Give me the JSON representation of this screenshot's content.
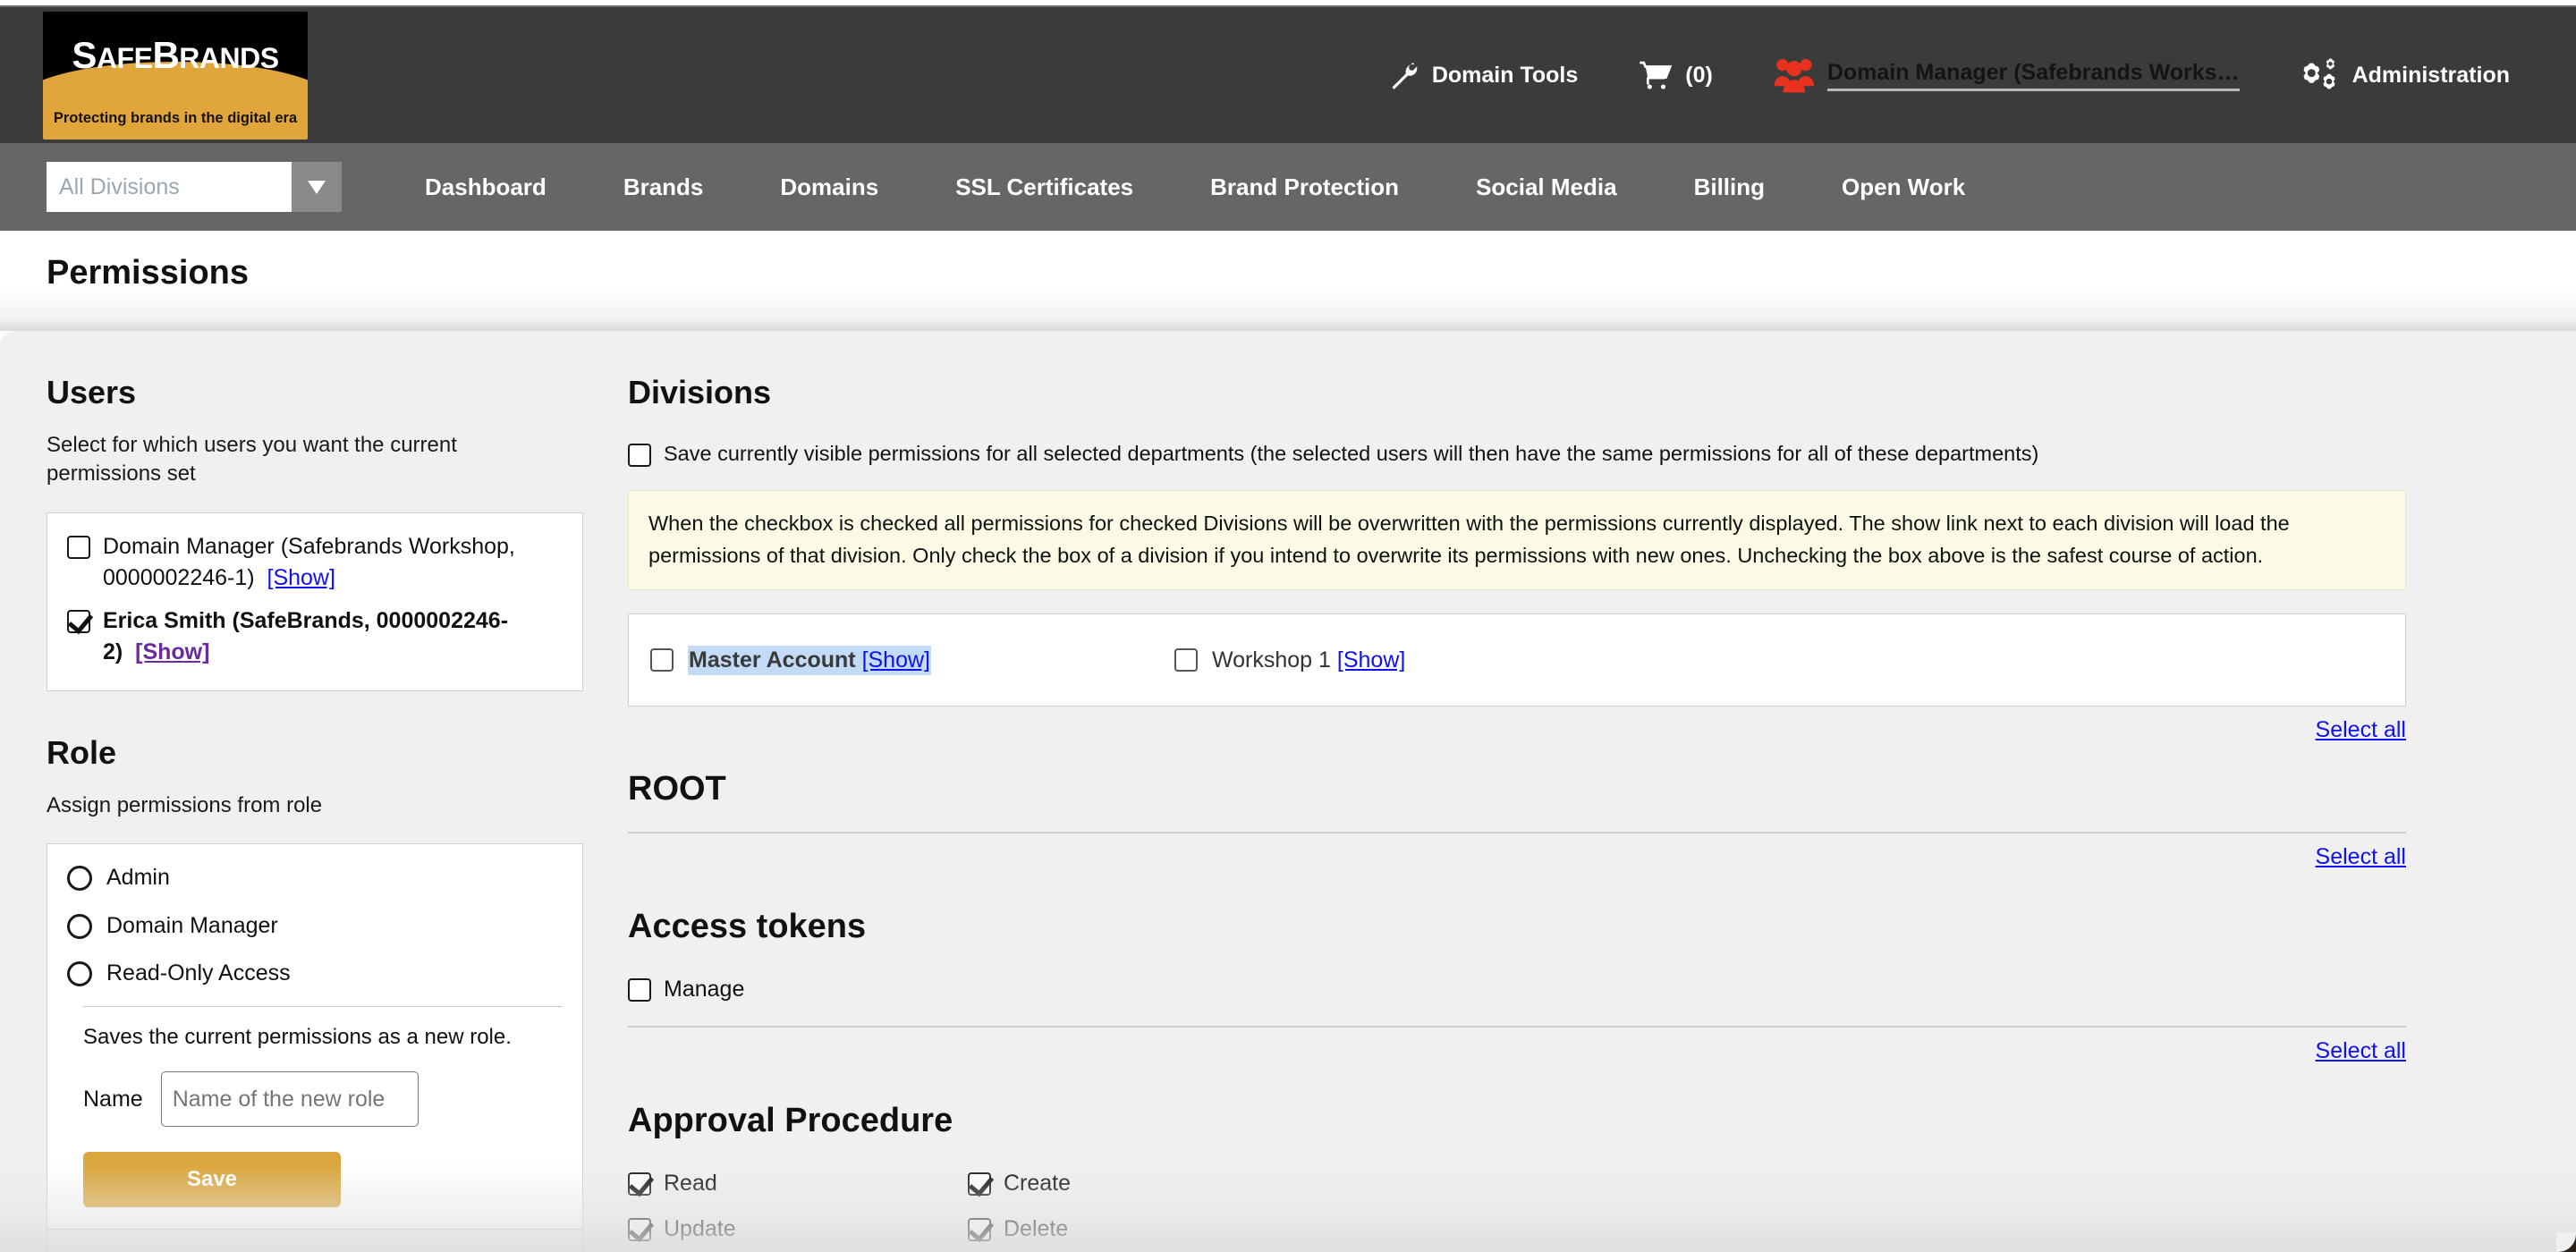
{
  "brand": {
    "logo_title_parts": [
      "S",
      "AFE",
      "B",
      "RANDS"
    ],
    "logo_tagline": "Protecting brands in the digital era"
  },
  "header": {
    "items": [
      {
        "label": "Domain Tools",
        "icon": "wrench-icon"
      },
      {
        "label": "(0)",
        "icon": "cart-icon"
      },
      {
        "label": "Domain Manager (Safebrands Works…",
        "icon": "users-icon"
      },
      {
        "label": "Administration",
        "icon": "gears-icon"
      }
    ]
  },
  "navbar": {
    "division_placeholder": "All Divisions",
    "division_value": "",
    "links": [
      "Dashboard",
      "Brands",
      "Domains",
      "SSL Certificates",
      "Brand Protection",
      "Social Media",
      "Billing",
      "Open Work"
    ]
  },
  "page": {
    "title": "Permissions"
  },
  "users": {
    "heading": "Users",
    "description": "Select for which users you want the current permissions set",
    "items": [
      {
        "label": "Domain Manager (Safebrands Workshop, 0000002246-1)",
        "show_link": "[Show]",
        "checked": false,
        "bold": false,
        "visited": false
      },
      {
        "label": "Erica Smith (SafeBrands, 0000002246-2)",
        "show_link": "[Show]",
        "checked": true,
        "bold": true,
        "visited": true
      }
    ]
  },
  "role": {
    "heading": "Role",
    "description": "Assign permissions from role",
    "options": [
      "Admin",
      "Domain Manager",
      "Read-Only Access"
    ],
    "note": "Saves the current permissions as a new role.",
    "name_label": "Name",
    "name_placeholder": "Name of the new role",
    "name_value": "",
    "save_label": "Save"
  },
  "divisions": {
    "heading": "Divisions",
    "save_all_label": "Save currently visible permissions for all selected departments (the selected users will then have the same permissions for all of these departments)",
    "save_all_checked": false,
    "warning": "When the checkbox is checked all permissions for checked Divisions will be overwritten with the permissions currently displayed. The show link next to each division will load the permissions of that division. Only check the box of a division if you intend to overwrite its permissions with new ones. Unchecking the box above is the safest course of action.",
    "items": [
      {
        "label": "Master Account",
        "show_link": "[Show]",
        "checked": false,
        "selected": true
      },
      {
        "label": "Workshop 1",
        "show_link": "[Show]",
        "checked": false,
        "selected": false
      }
    ],
    "select_all_label": "Select all"
  },
  "sections": [
    {
      "heading": "ROOT",
      "select_all_label": "Select all",
      "permissions": []
    },
    {
      "heading": "Access tokens",
      "select_all_label": "Select all",
      "permissions": [
        {
          "label": "Manage",
          "checked": false
        }
      ]
    },
    {
      "heading": "Approval Procedure",
      "select_all_label": "",
      "permissions": [
        {
          "label": "Read",
          "checked": true
        },
        {
          "label": "Create",
          "checked": true
        },
        {
          "label": "Update",
          "checked": true
        },
        {
          "label": "Delete",
          "checked": true
        }
      ]
    }
  ],
  "colors": {
    "header_bg": "#3b3b3b",
    "navbar_bg": "#666666",
    "brand_orange": "#e0a63c",
    "accent_red": "#e8321e",
    "link_blue": "#1111ee",
    "link_visited": "#6b2ba0",
    "warning_bg": "#fbfae4",
    "selection_blue": "#c3dbf7"
  }
}
